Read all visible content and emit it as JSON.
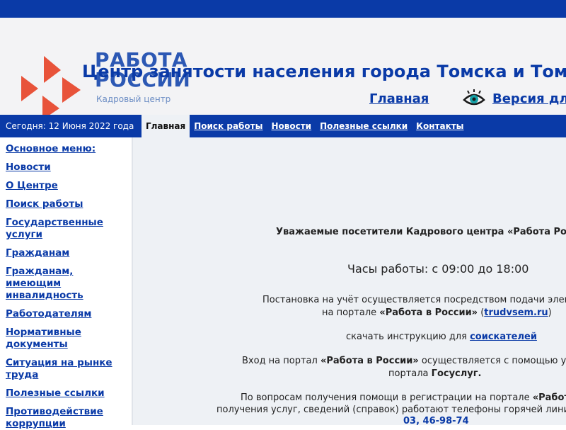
{
  "logo": {
    "line1": "РАБОТА",
    "line2": "РОССИИ",
    "sub": "Кадровый центр"
  },
  "header": {
    "title": "Центр занятости населения города Томска и Томс",
    "link_main": "Главная",
    "link_vision": "Версия дл"
  },
  "navbar": {
    "date": "Сегодня: 12 Июня 2022 года",
    "items": [
      {
        "label": "Главная"
      },
      {
        "label": "Поиск работы"
      },
      {
        "label": "Новости"
      },
      {
        "label": "Полезные ссылки"
      },
      {
        "label": "Контакты"
      }
    ]
  },
  "sidebar": {
    "items": [
      {
        "label": "Основное меню:"
      },
      {
        "label": "Новости"
      },
      {
        "label": "О Центре"
      },
      {
        "label": "Поиск работы"
      },
      {
        "label": "Государственные услуги"
      },
      {
        "label": "Гражданам"
      },
      {
        "label": "Гражданам, имеющим инвалидность"
      },
      {
        "label": "Работодателям"
      },
      {
        "label": "Нормативные документы"
      },
      {
        "label": "Ситуация на рынке труда"
      },
      {
        "label": "Полезные ссылки"
      },
      {
        "label": "Противодействие коррупции"
      }
    ]
  },
  "main": {
    "greeting": "Уважаемые посетители Кадрового центра «Работа Рос",
    "hours": "Часы работы: с 09:00 до 18:00",
    "reg_line1": "Постановка на учёт осуществляется посредством подачи электронного",
    "reg_line2_pre": "на портале ",
    "reg_line2_portal": "«Работа в России»",
    "reg_line2_open": " (",
    "reg_line2_link": "trudvsem.ru",
    "reg_line2_close": ")",
    "instr_pre": "скачать инструкцию для ",
    "instr_link": "соискателей",
    "login_pre": "Вход на портал ",
    "login_portal": "«Работа в России»",
    "login_post": " осуществляется с помощью у",
    "login2_pre": "портала ",
    "login2_bold": "Госуслуг.",
    "help_pre": "По вопросам получения помощи в регистрации на портале ",
    "help_bold": "«Работ",
    "help2": "получения услуг, сведений (справок) работают телефоны горячей лини",
    "phones": "03,  46-98-74"
  }
}
